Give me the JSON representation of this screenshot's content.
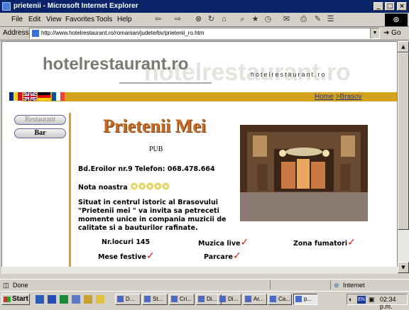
{
  "window": {
    "title": "prietenii - Microsoft Internet Explorer"
  },
  "menu": {
    "file": "File",
    "edit": "Edit",
    "favorites": "Favorites",
    "tools": "Tools",
    "help": "Help"
  },
  "address": {
    "label": "Address",
    "url": "http://www.hotelrestaurant.ro/romanian/judete/bv/prietenii_ro.htm",
    "go_label": "Go"
  },
  "site": {
    "logo": "hotelrestaurant.ro",
    "logo_large": "hotelrestaurant.ro",
    "logo_small": "hotelrestaurant.ro",
    "breadcrumb": {
      "home": "Home",
      "separator": ">",
      "city": "Brasov"
    },
    "nav": {
      "restaurant": "Restaurant",
      "bar": "Bar"
    },
    "colors": {
      "accent_gold": "#d4a21d",
      "title_orange": "#c46a24",
      "link_blue": "#1a2f8a",
      "check_red": "#d81818"
    }
  },
  "venue": {
    "name": "Prietenii Mei",
    "type": "PUB",
    "address": "Bd.Eroilor nr.9 Telefon: 068.478.664",
    "rating_label": "Nota noastra",
    "rating": 5,
    "description": "Situat in centrul istoric al Brasovului \"Prietenii mei \" va invita sa petreceti momente unice in compania muzicii de calitate si a bauturilor rafinate.",
    "features": {
      "seats": "Nr.locuri 145",
      "live_music": "Muzica live",
      "smoking": "Zona fumatori",
      "parties": "Mese festive",
      "parking": "Parcare"
    },
    "check_icon": "check-icon"
  },
  "status": {
    "text": "Done",
    "zone": "Internet"
  },
  "taskbar": {
    "start": "Start",
    "tasks": [
      "D...",
      "St...",
      "Cri...",
      "Di...",
      "Di...",
      "Ar...",
      "Ca...",
      "p..."
    ],
    "lang": "EN",
    "clock": "02:34 p.m."
  }
}
